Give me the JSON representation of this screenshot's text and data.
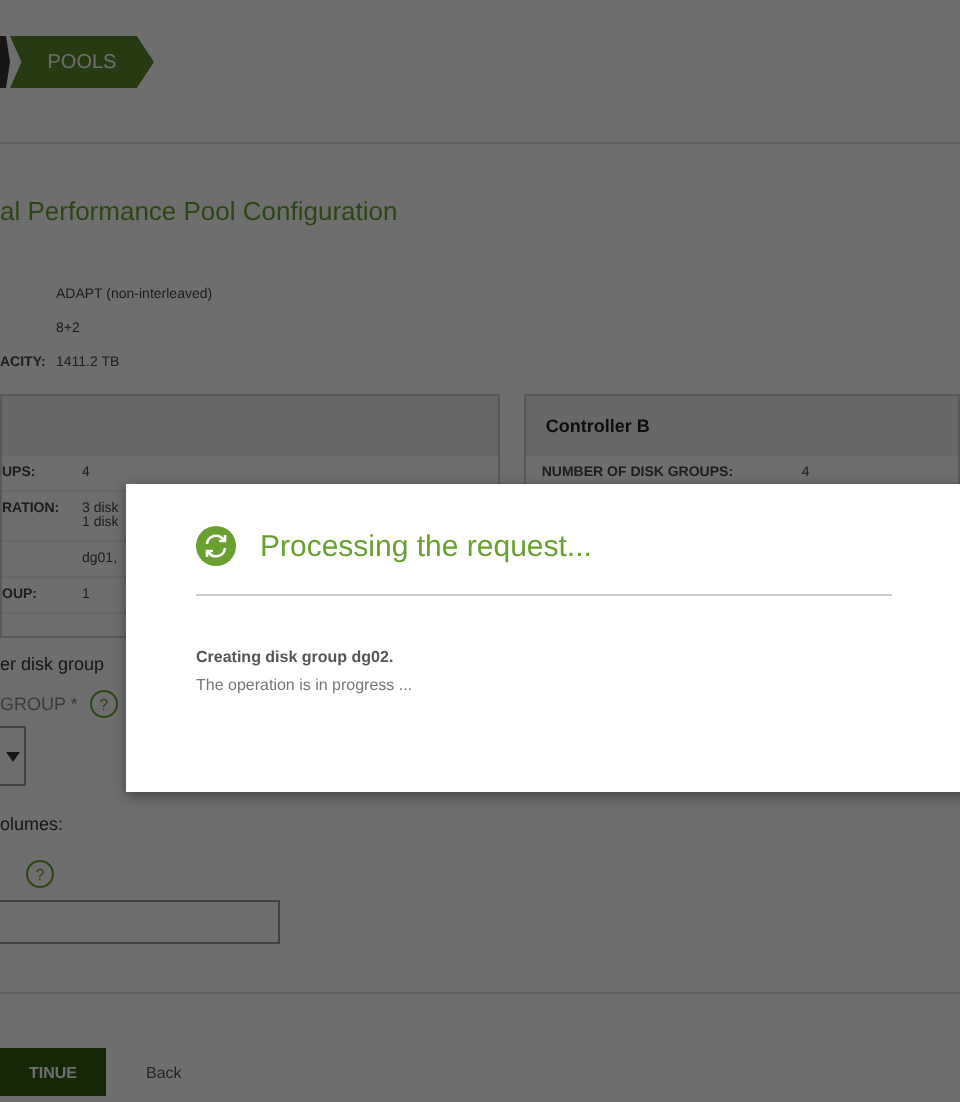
{
  "breadcrumb": [
    {
      "label": "POOLS",
      "selected": true
    }
  ],
  "title": "al Performance Pool Configuration",
  "summary": [
    {
      "value": "ADAPT (non-interleaved)"
    },
    {
      "value": "8+2"
    },
    {
      "label": "ACITY:",
      "value": "1411.2 TB"
    }
  ],
  "controller_a": {
    "rows": [
      {
        "label": "UPS:",
        "values": [
          "4"
        ]
      },
      {
        "label": "RATION:",
        "values": [
          "3 disk",
          "1 disk"
        ]
      },
      {
        "values": [
          "dg01, "
        ]
      },
      {
        "label": "OUP:",
        "values": [
          "1"
        ]
      }
    ]
  },
  "controller_b": {
    "title": "Controller B",
    "rows": [
      {
        "label": "NUMBER OF DISK GROUPS:",
        "values": [
          "4"
        ]
      }
    ]
  },
  "form": {
    "intro": "er disk group",
    "group_label": "GROUP *",
    "group_help": "?",
    "volumes_label": "olumes:",
    "volumes_help": "?"
  },
  "buttons": [
    {
      "label": "TINUE",
      "kind": "primary"
    },
    {
      "label": "Back",
      "kind": "link"
    }
  ],
  "dialog": {
    "title": "Processing the request...",
    "message": "Creating disk group dg02.",
    "detail": "The operation is in progress ..."
  }
}
